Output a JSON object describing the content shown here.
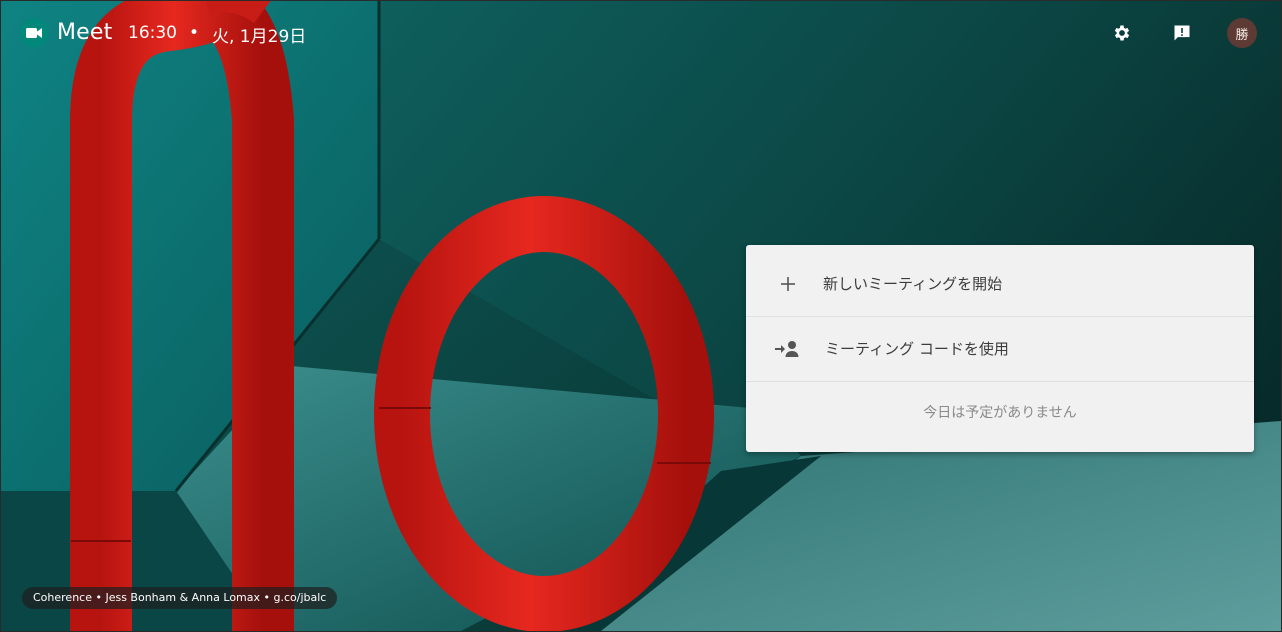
{
  "header": {
    "brand": "Meet",
    "time": "16:30",
    "separator": "•",
    "date": "火, 1月29日",
    "avatar_initial": "勝"
  },
  "icons": {
    "logo": "meet-logo-icon",
    "settings": "gear-icon",
    "feedback": "feedback-icon",
    "new_meeting": "plus-icon",
    "join": "person-join-icon"
  },
  "menu": {
    "new_meeting_label": "新しいミーティングを開始",
    "join_label": "ミーティング コードを使用",
    "empty_note": "今日は予定がありません"
  },
  "credit": {
    "text": "Coherence  •  Jess Bonham & Anna Lomax  •  g.co/jbalc"
  },
  "colors": {
    "accent_green": "#00897b",
    "card_bg": "#f1f1f1",
    "avatar_bg": "#5d3a33"
  }
}
